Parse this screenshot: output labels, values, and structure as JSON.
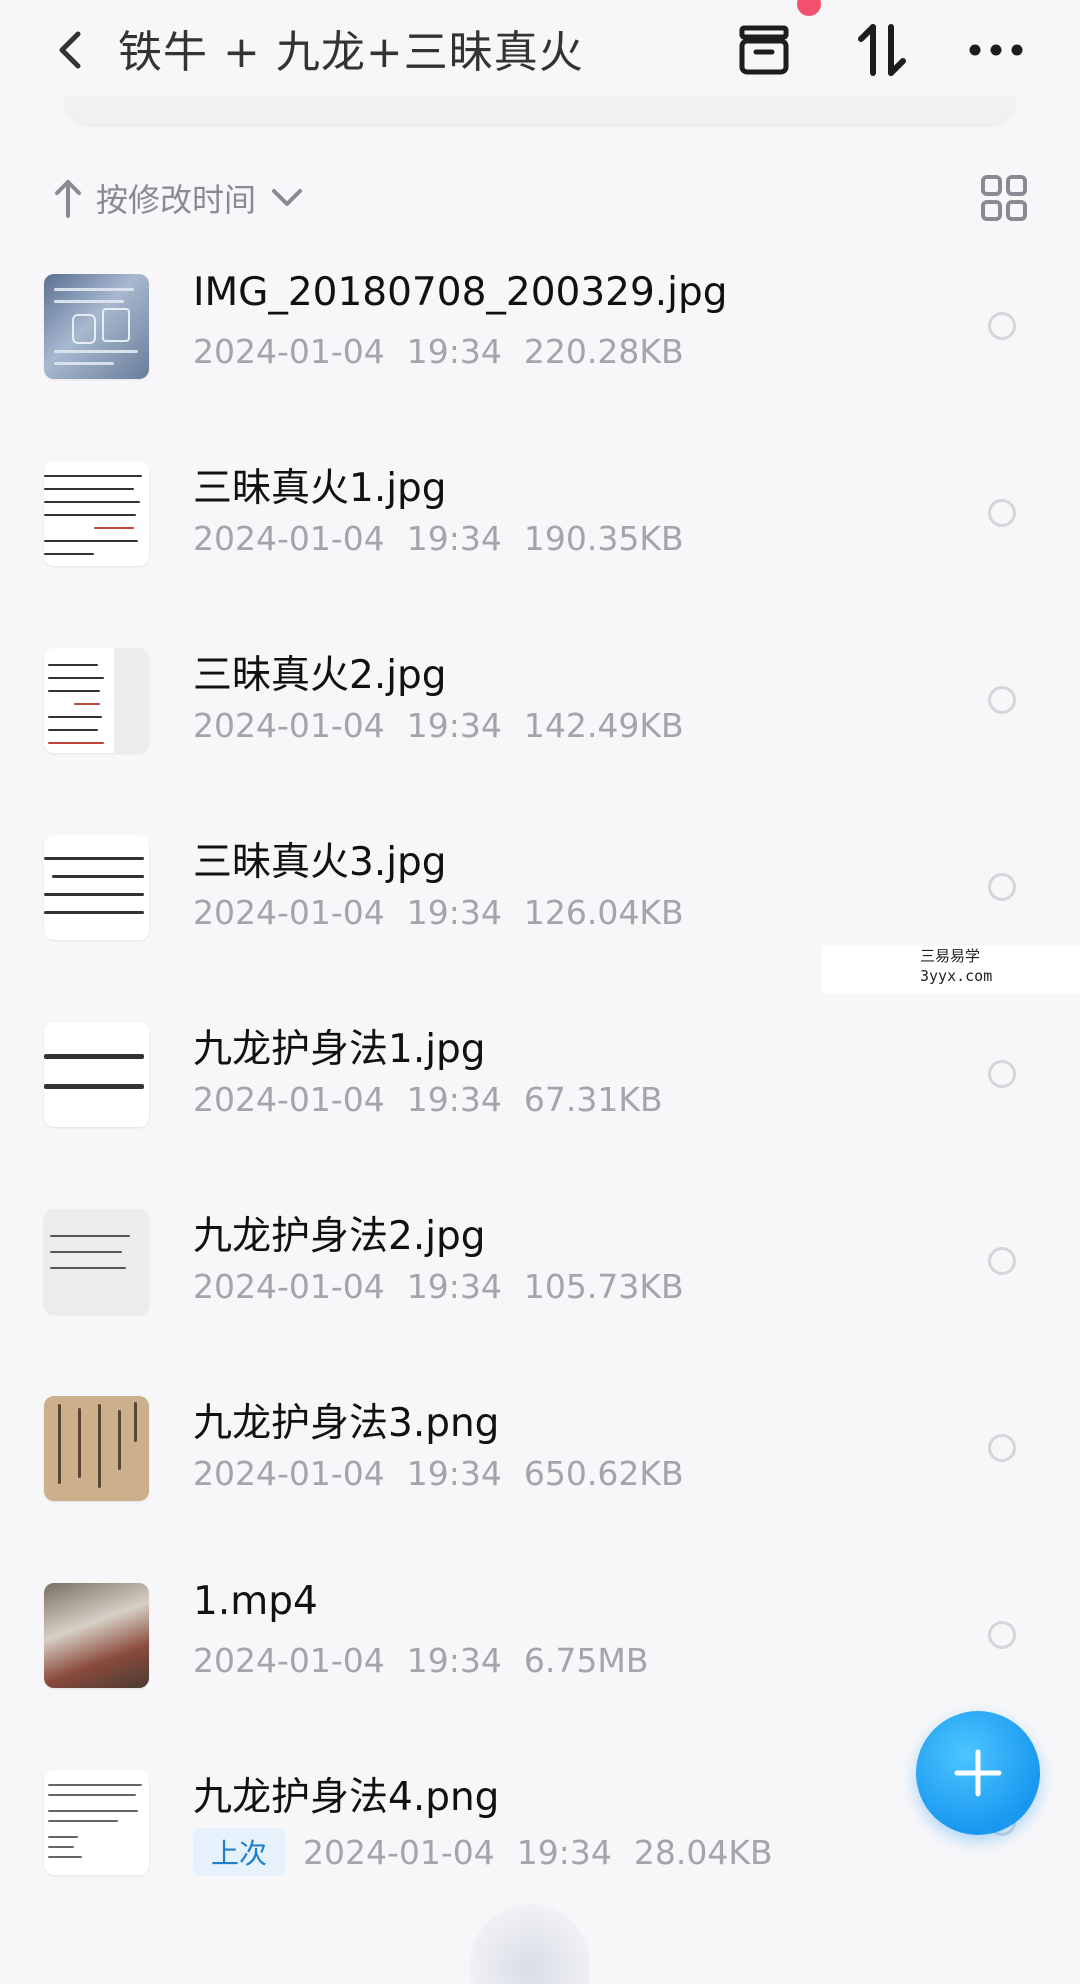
{
  "header": {
    "title": "铁牛 + 九龙+三昧真火",
    "icons": [
      "back-chevron-icon",
      "archive-box-icon",
      "sort-swap-icon",
      "more-dots-icon"
    ]
  },
  "sort": {
    "label": "按修改时间",
    "direction": "ascending"
  },
  "watermark": {
    "line1": "三易易学",
    "line2": "3yyx.com"
  },
  "files": [
    {
      "name": "IMG_20180708_200329.jpg",
      "date": "2024-01-04",
      "time": "19:34",
      "size": "220.28KB",
      "thumb": "photo"
    },
    {
      "name": "三昧真火1.jpg",
      "date": "2024-01-04",
      "time": "19:34",
      "size": "190.35KB",
      "thumb": "doc"
    },
    {
      "name": "三昧真火2.jpg",
      "date": "2024-01-04",
      "time": "19:34",
      "size": "142.49KB",
      "thumb": "doc"
    },
    {
      "name": "三昧真火3.jpg",
      "date": "2024-01-04",
      "time": "19:34",
      "size": "126.04KB",
      "thumb": "doc"
    },
    {
      "name": "九龙护身法1.jpg",
      "date": "2024-01-04",
      "time": "19:34",
      "size": "67.31KB",
      "thumb": "doc"
    },
    {
      "name": "九龙护身法2.jpg",
      "date": "2024-01-04",
      "time": "19:34",
      "size": "105.73KB",
      "thumb": "doc"
    },
    {
      "name": "九龙护身法3.png",
      "date": "2024-01-04",
      "time": "19:34",
      "size": "650.62KB",
      "thumb": "paper"
    },
    {
      "name": "1.mp4",
      "date": "2024-01-04",
      "time": "19:34",
      "size": "6.75MB",
      "thumb": "video"
    },
    {
      "name": "九龙护身法4.png",
      "badge": "上次",
      "date": "2024-01-04",
      "time": "19:34",
      "size": "28.04KB",
      "thumb": "doc"
    }
  ],
  "colors": {
    "accent": "#1a98f0",
    "notification": "#f2506c",
    "meta_text": "#a4a4ab"
  }
}
